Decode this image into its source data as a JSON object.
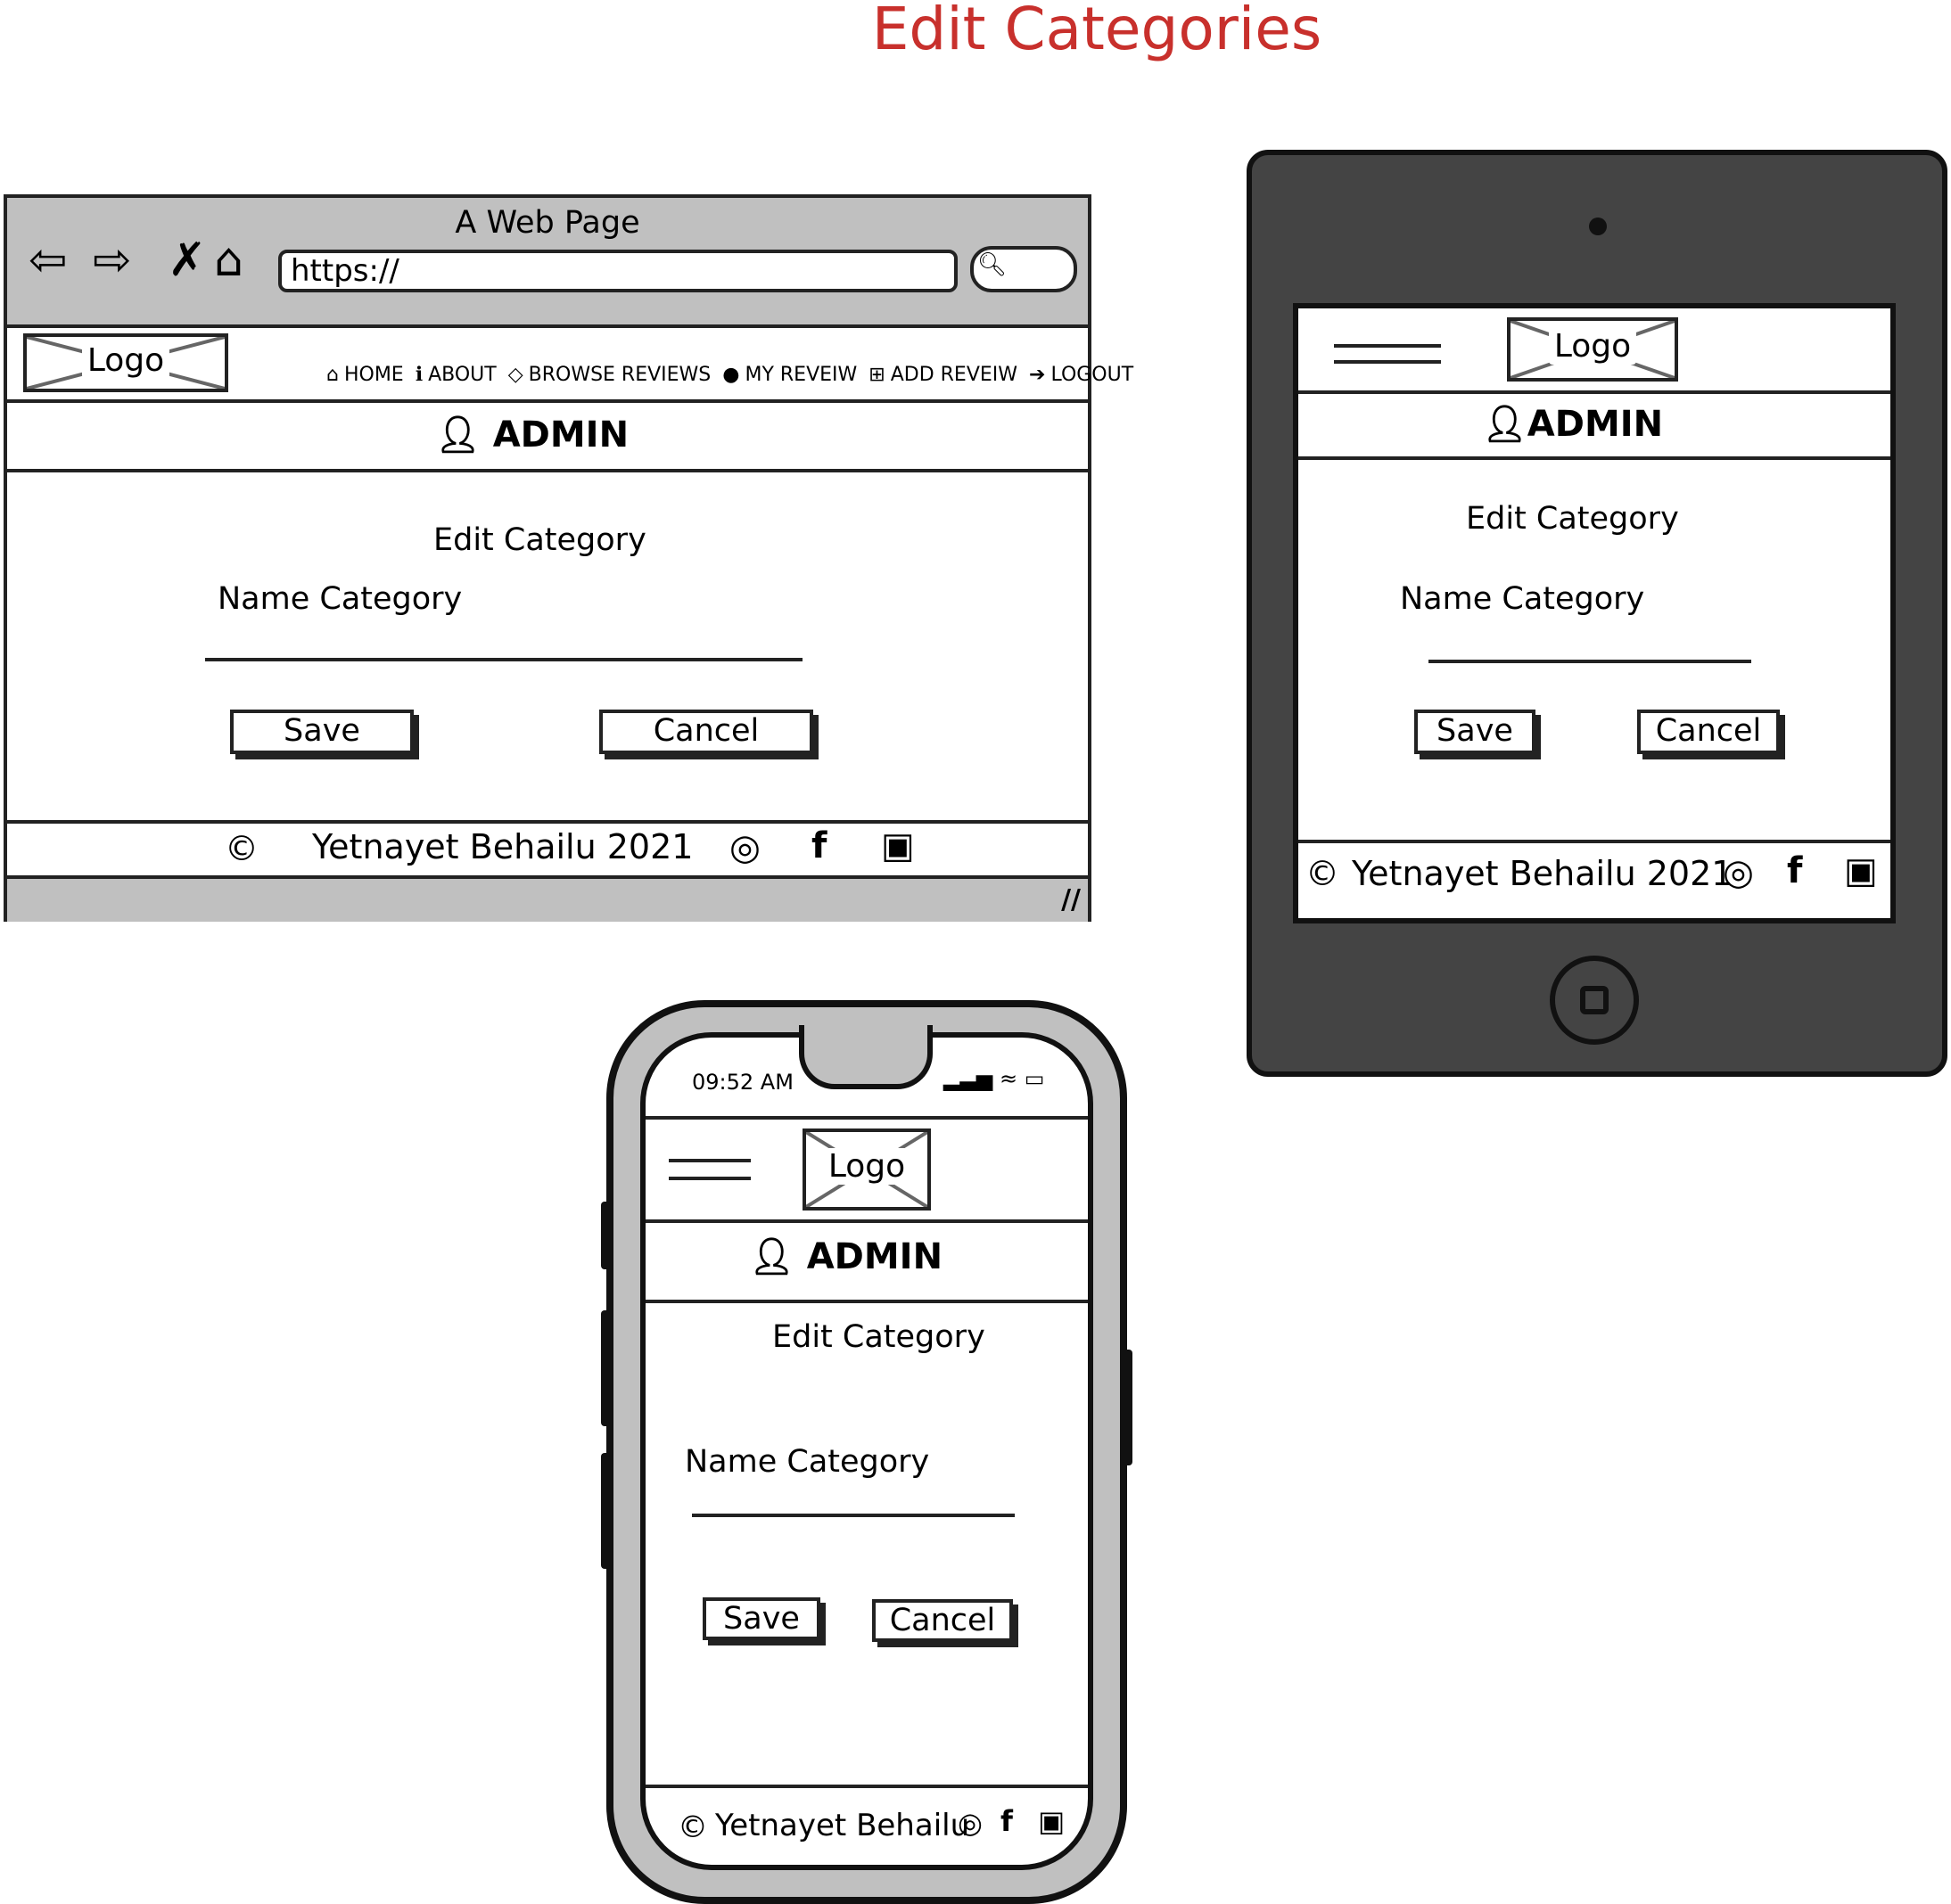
{
  "page_title": "Edit Categories",
  "desktop": {
    "window_title": "A Web Page",
    "url": "https://",
    "logo": "Logo",
    "nav": [
      "HOME",
      "ABOUT",
      "BROWSE REVIEWS",
      "MY REVEIW",
      "ADD REVEIW",
      "LOGOUT"
    ],
    "admin": "ADMIN",
    "form_title": "Edit Category",
    "field_label": "Name Category",
    "save": "Save",
    "cancel": "Cancel",
    "footer": "Yetnayet Behailu 2021",
    "copyright": "©"
  },
  "tablet": {
    "logo": "Logo",
    "admin": "ADMIN",
    "form_title": "Edit Category",
    "field_label": "Name Category",
    "save": "Save",
    "cancel": "Cancel",
    "footer": "Yetnayet Behailu 2021",
    "copyright": "©"
  },
  "phone": {
    "time": "09:52 AM",
    "logo": "Logo",
    "admin": "ADMIN",
    "form_title": "Edit Category",
    "field_label": "Name Category",
    "save": "Save",
    "cancel": "Cancel",
    "footer": "Yetnayet Behailu",
    "copyright": "©"
  },
  "icons": [
    "back-arrow-icon",
    "forward-arrow-icon",
    "close-icon",
    "home-icon",
    "search-icon",
    "info-icon",
    "diamond-icon",
    "user-icon",
    "plus-square-icon",
    "logout-icon",
    "instagram-icon",
    "facebook-icon",
    "twitter-icon",
    "signal-icon",
    "wifi-icon",
    "battery-icon",
    "resize-grip-icon"
  ],
  "colors": {
    "title": "#c8302c",
    "chrome": "#c0c0c0",
    "tablet_body": "#444444",
    "ink": "#222222"
  }
}
